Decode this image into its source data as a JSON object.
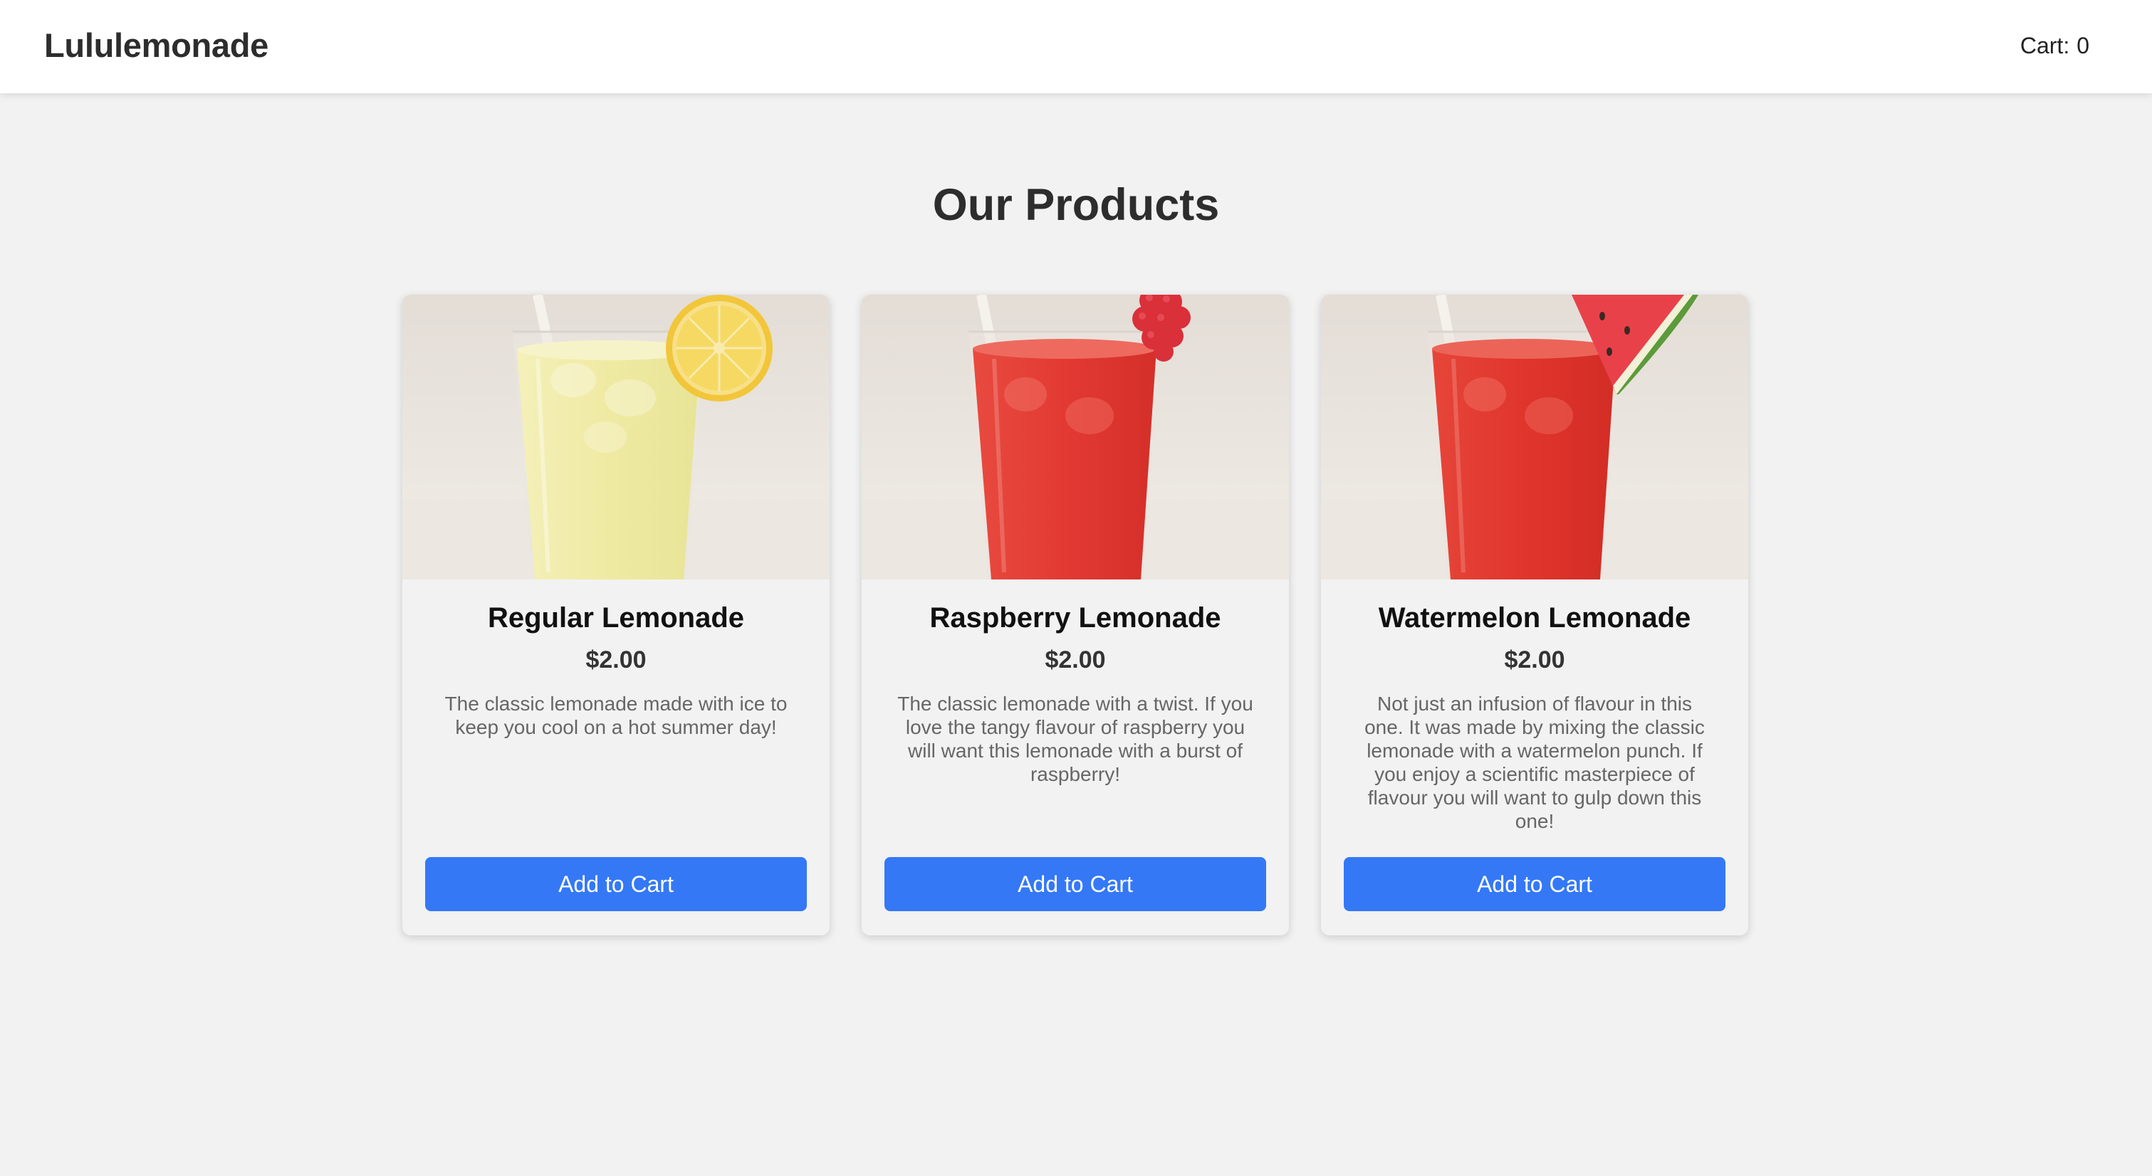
{
  "header": {
    "brand": "Lululemonade",
    "cart_label": "Cart:",
    "cart_count": "0"
  },
  "main": {
    "title": "Our Products"
  },
  "products": [
    {
      "name": "Regular Lemonade",
      "price": "$2.00",
      "description": "The classic lemonade made with ice to keep you cool on a hot summer day!",
      "button_label": "Add to Cart",
      "garnish": "lemon-slice",
      "drink_color": "#f2efaa"
    },
    {
      "name": "Raspberry Lemonade",
      "price": "$2.00",
      "description": "The classic lemonade with a twist. If you love the tangy flavour of raspberry you will want this lemonade with a burst of raspberry!",
      "button_label": "Add to Cart",
      "garnish": "raspberry",
      "drink_color": "#e23a33"
    },
    {
      "name": "Watermelon Lemonade",
      "price": "$2.00",
      "description": "Not just an infusion of flavour in this one. It was made by mixing the classic lemonade with a watermelon punch. If you enjoy a scientific masterpiece of flavour you will want to gulp down this one!",
      "button_label": "Add to Cart",
      "garnish": "watermelon-slice",
      "drink_color": "#e0352c"
    }
  ],
  "colors": {
    "accent": "#3478f6",
    "background": "#f2f2f2",
    "header_bg": "#ffffff"
  }
}
